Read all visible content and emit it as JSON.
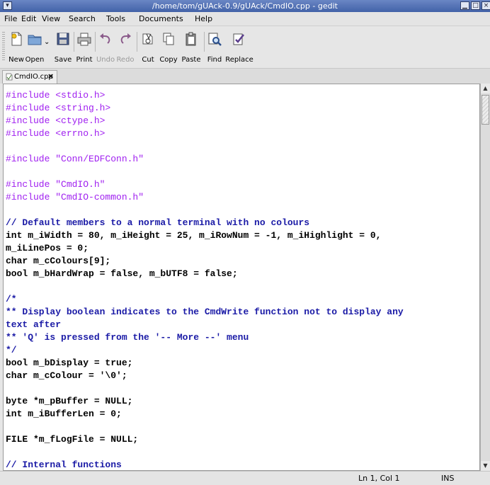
{
  "window": {
    "title": "/home/tom/gUAck-0.9/gUAck/CmdIO.cpp - gedit"
  },
  "menubar": {
    "items": [
      "File",
      "Edit",
      "View",
      "Search",
      "Tools",
      "Documents",
      "Help"
    ]
  },
  "toolbar": {
    "new_label": "New",
    "open_label": "Open",
    "save_label": "Save",
    "print_label": "Print",
    "undo_label": "Undo",
    "redo_label": "Redo",
    "cut_label": "Cut",
    "copy_label": "Copy",
    "paste_label": "Paste",
    "find_label": "Find",
    "replace_label": "Replace"
  },
  "tab": {
    "filename": "CmdIO.cpp",
    "close": "×"
  },
  "editor": {
    "lines": [
      "#include <stdio.h>",
      "#include <string.h>",
      "#include <ctype.h>",
      "#include <errno.h>",
      "",
      "#include \"Conn/EDFConn.h\"",
      "",
      "#include \"CmdIO.h\"",
      "#include \"CmdIO-common.h\"",
      "",
      "// Default members to a normal terminal with no colours",
      "int m_iWidth = 80, m_iHeight = 25, m_iRowNum = -1, m_iHighlight = 0,",
      "m_iLinePos = 0;",
      "char m_cColours[9];",
      "bool m_bHardWrap = false, m_bUTF8 = false;",
      "",
      "/*",
      "** Display boolean indicates to the CmdWrite function not to display any",
      "text after",
      "** 'Q' is pressed from the '-- More --' menu",
      "*/",
      "bool m_bDisplay = true;",
      "char m_cColour = '\\0';",
      "",
      "byte *m_pBuffer = NULL;",
      "int m_iBufferLen = 0;",
      "",
      "FILE *m_fLogFile = NULL;",
      "",
      "// Internal functions"
    ]
  },
  "statusbar": {
    "position": "Ln 1, Col 1",
    "mode": "INS"
  }
}
